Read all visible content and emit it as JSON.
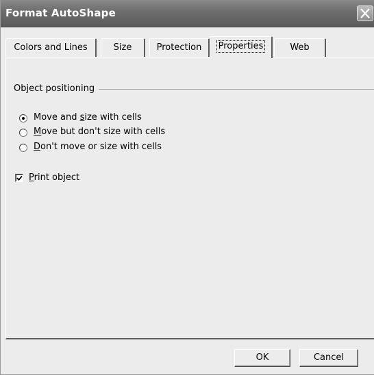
{
  "window": {
    "title": "Format AutoShape"
  },
  "tabs": [
    {
      "label": "Colors and Lines"
    },
    {
      "label": "Size"
    },
    {
      "label": "Protection"
    },
    {
      "label": "Properties",
      "active": true
    },
    {
      "label": "Web"
    }
  ],
  "object_positioning": {
    "group_label": "Object positioning",
    "options": [
      {
        "label_pre": "Move and ",
        "label_mn": "s",
        "label_post": "ize with cells",
        "selected": true
      },
      {
        "label_pre": "",
        "label_mn": "M",
        "label_post": "ove but don't size with cells",
        "selected": false
      },
      {
        "label_pre": "",
        "label_mn": "D",
        "label_post": "on't move or size with cells",
        "selected": false
      }
    ]
  },
  "print_object": {
    "label_mn": "P",
    "label_post": "rint object",
    "checked": true
  },
  "buttons": {
    "ok": "OK",
    "cancel": "Cancel"
  },
  "icons": {
    "close": "close-icon",
    "radio_selected": "radio-selected-icon",
    "radio_unselected": "radio-unselected-icon",
    "check": "checkmark-icon"
  }
}
